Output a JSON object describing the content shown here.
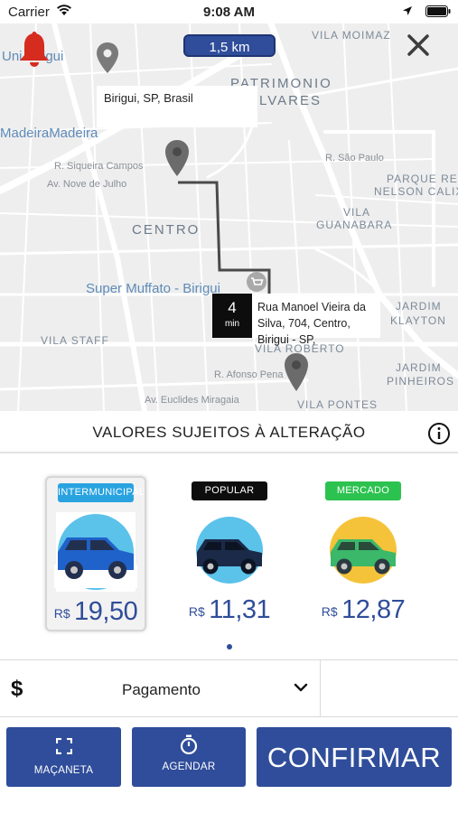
{
  "status_bar": {
    "carrier": "Carrier",
    "time": "9:08 AM"
  },
  "map": {
    "distance": "1,5 km",
    "origin_label": "Birigui, SP, Brasil",
    "destination": {
      "eta_value": "4",
      "eta_unit": "min",
      "address": "Rua Manoel Vieira da Silva, 704, Centro, Birigui - SP,"
    },
    "labels": {
      "vila_moimaz": "VILA MOIMAZ",
      "patrimonio": "PATRIMONIO",
      "alvares": "ALVARES",
      "uni_birigui": "Uni     Birigui",
      "madeira": "MadeiraMadeira",
      "siqueira": "R. Siqueira Campos",
      "nove_julho": "Av. Nove de Julho",
      "sao_paulo": "R. São Paulo",
      "parque_res": "PARQUE RES",
      "nelson_calix": "NELSON CALIX",
      "vila": "VILA",
      "guanabara": "GUANABARA",
      "centro": "CENTRO",
      "super_muffato": "Super Muffato - Birigui",
      "jardim1": "JARDIM",
      "klayton": "KLAYTON",
      "vila_staff": "VILA STAFF",
      "vila_roberto": "VILA ROBERTO",
      "afonso_pena": "R. Afonso Pena",
      "jardim2": "JARDIM",
      "pinheiros": "PINHEIROS",
      "euclides": "Av. Euclides Miragaia",
      "vila_pontes": "VILA PONTES"
    }
  },
  "sheet": {
    "title": "VALORES SUJEITOS À ALTERAÇÃO",
    "options": [
      {
        "badge": "INTERMUNICIPAL",
        "badge_color": "#29a3e0",
        "currency": "R$",
        "price": "19,50",
        "car_color": "#1f62c9",
        "circle_color": "#5bc2ea",
        "selected": true
      },
      {
        "badge": "POPULAR",
        "badge_color": "#0d0d0d",
        "currency": "R$",
        "price": "11,31",
        "car_color": "#1a2a48",
        "circle_color": "#5bc2ea",
        "selected": false
      },
      {
        "badge": "MERCADO",
        "badge_color": "#2cc24f",
        "currency": "R$",
        "price": "12,87",
        "car_color": "#3bb86a",
        "circle_color": "#f5c33a",
        "selected": false
      }
    ],
    "payment": {
      "symbol": "$",
      "label": "Pagamento"
    },
    "actions": {
      "macaneta": "MAÇANETA",
      "agendar": "AGENDAR",
      "confirmar": "CONFIRMAR"
    }
  },
  "colors": {
    "primary": "#2f4d9a",
    "bell": "#d62b1f",
    "route": "#4a4a4a",
    "pin": "#6b6b6b"
  },
  "icons": {
    "bell": "bell-icon",
    "close": "close-icon",
    "pin": "map-pin-icon",
    "info": "info-icon",
    "expand": "expand-icon",
    "timer": "stopwatch-icon",
    "chevron": "chevron-down-icon"
  }
}
